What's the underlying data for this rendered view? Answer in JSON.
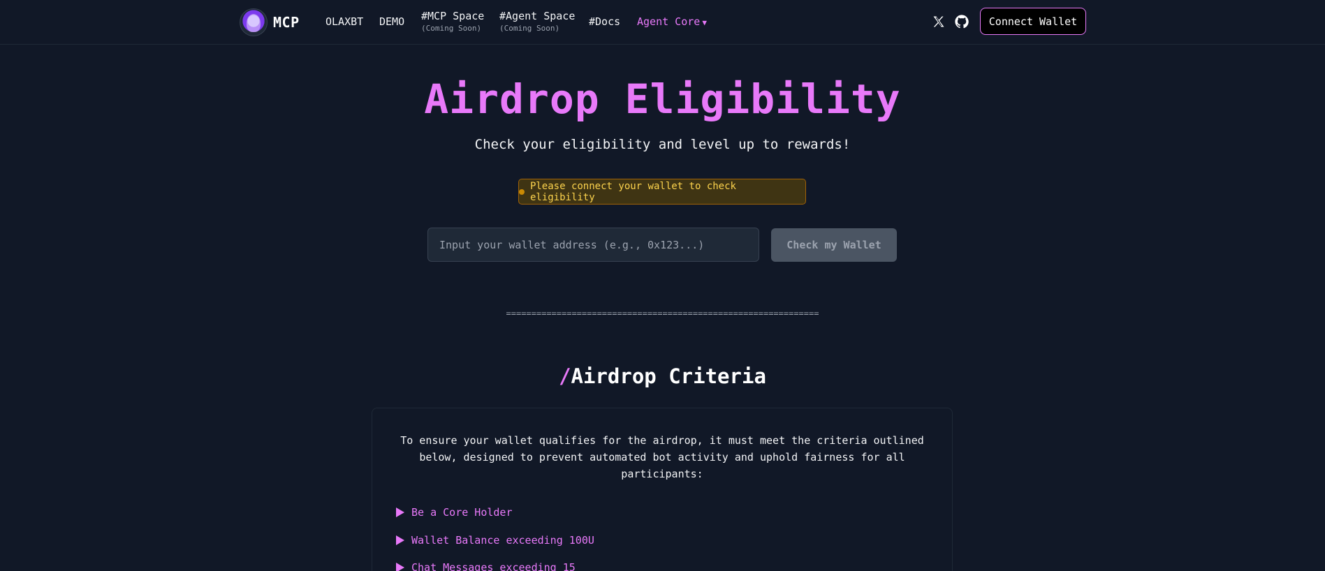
{
  "header": {
    "logo_text": "MCP",
    "nav": {
      "olaxbt": "OLAXBT",
      "demo": "DEMO",
      "mcp_space": "#MCP Space",
      "mcp_space_sub": "(Coming Soon)",
      "agent_space": "#Agent Space",
      "agent_space_sub": "(Coming Soon)",
      "docs": "#Docs",
      "agent_core": "Agent Core",
      "agent_core_caret": "▼"
    },
    "icons": [
      "x-icon",
      "github-icon"
    ],
    "connect_label": "Connect Wallet"
  },
  "hero": {
    "title": "Airdrop Eligibility",
    "subtitle": "Check your eligibility and level up to rewards!",
    "notice": "Please connect your wallet to check eligibility",
    "input_placeholder": "Input your wallet address (e.g., 0x123...)",
    "input_value": "",
    "check_label": "Check my Wallet",
    "divider": "=============================================================="
  },
  "criteria": {
    "slash": "/",
    "title": "Airdrop Criteria",
    "intro": "To ensure your wallet qualifies for the airdrop, it must meet the criteria outlined below, designed to prevent automated bot activity and uphold fairness for all participants:",
    "items": [
      {
        "label": "Be a Core Holder"
      },
      {
        "label": "Wallet Balance exceeding 100U"
      },
      {
        "label": "Chat Messages exceeding 15"
      }
    ]
  },
  "colors": {
    "background": "#111827",
    "accent": "#e879f9",
    "notice_text": "#fcd34d",
    "notice_bg": "#3f3413"
  }
}
